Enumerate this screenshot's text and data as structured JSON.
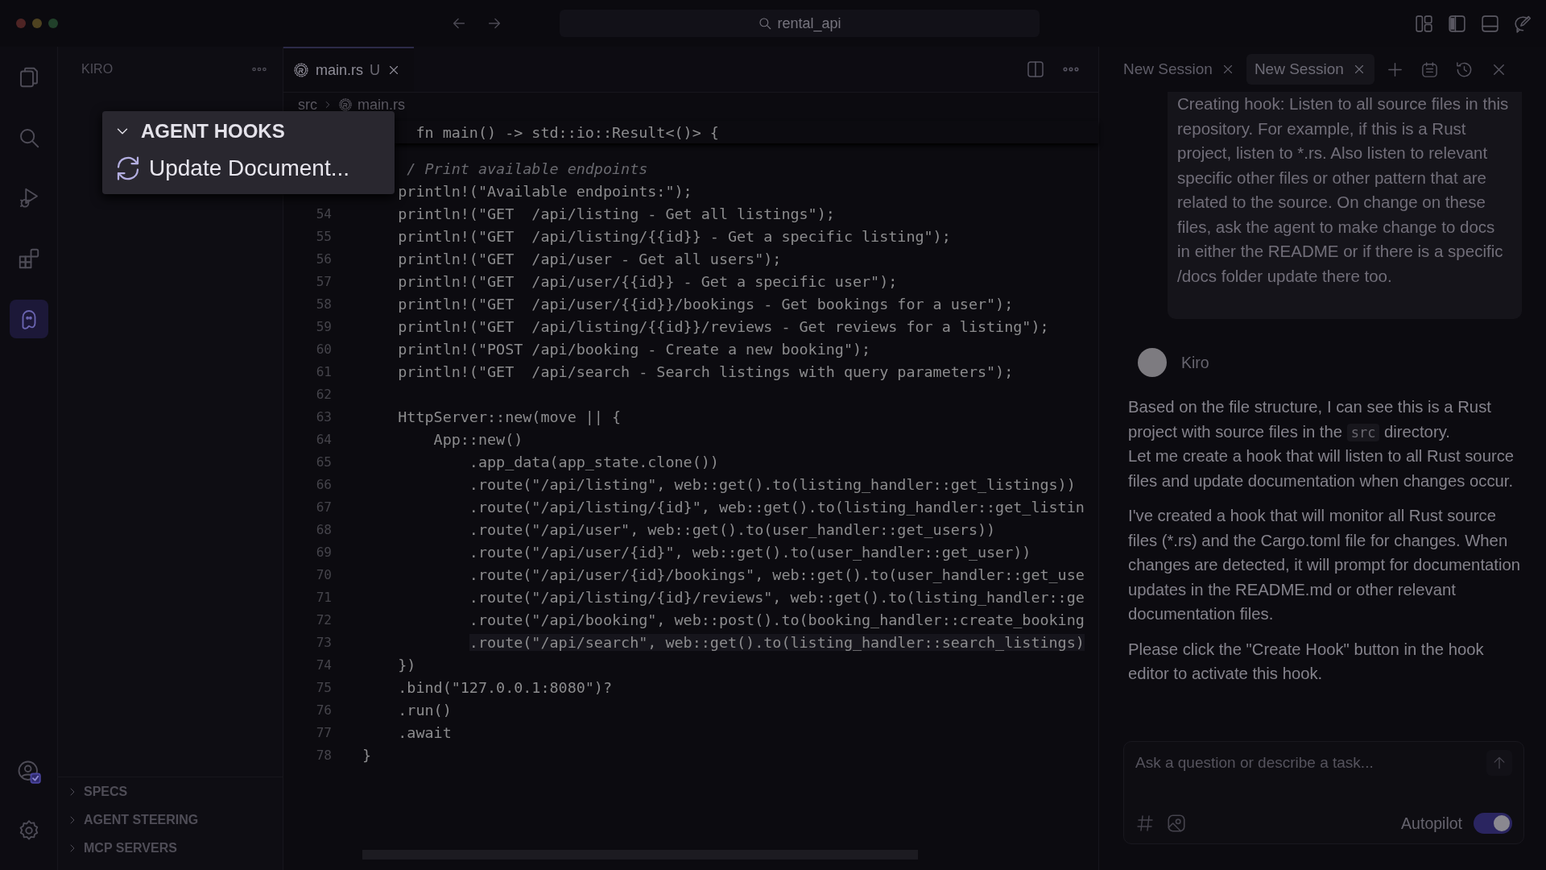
{
  "title_bar": {
    "search": "rental_api"
  },
  "activity_bar": {
    "top": [
      {
        "kind": "explorer",
        "selected": false
      },
      {
        "kind": "search",
        "selected": false
      },
      {
        "kind": "run",
        "selected": false
      },
      {
        "kind": "extensions",
        "selected": false
      },
      {
        "kind": "kiro",
        "selected": true
      }
    ],
    "bottom": [
      {
        "kind": "account",
        "selected": false
      },
      {
        "kind": "settings",
        "selected": false
      }
    ]
  },
  "sidebar": {
    "title": "KIRO",
    "sections": [
      {
        "label": "SPECS",
        "expanded": false
      },
      {
        "label": "AGENT STEERING",
        "expanded": false
      },
      {
        "label": "MCP SERVERS",
        "expanded": false
      }
    ]
  },
  "hooks_popup": {
    "title": "AGENT HOOKS",
    "expanded": true,
    "items": [
      {
        "label": "Update Document..."
      }
    ]
  },
  "editor": {
    "tabs": [
      {
        "label": "main.rs",
        "status": "U",
        "selected": true
      }
    ],
    "breadcrumb": [
      "src",
      "main.rs"
    ],
    "sticky_line": "      fn main() -> std::io::Result<()> {",
    "lines": [
      {
        "text": "     / Print available endpoints",
        "kind": "comment",
        "current": false
      },
      {
        "text": "    println!(\"Available endpoints:\");",
        "kind": "code",
        "current": false
      },
      {
        "number": "54",
        "text": "    println!(\"GET  /api/listing - Get all listings\");",
        "kind": "code",
        "current": false
      },
      {
        "number": "55",
        "text": "    println!(\"GET  /api/listing/{{id}} - Get a specific listing\");",
        "kind": "code",
        "current": false
      },
      {
        "number": "56",
        "text": "    println!(\"GET  /api/user - Get all users\");",
        "kind": "code",
        "current": false
      },
      {
        "number": "57",
        "text": "    println!(\"GET  /api/user/{{id}} - Get a specific user\");",
        "kind": "code",
        "current": false
      },
      {
        "number": "58",
        "text": "    println!(\"GET  /api/user/{{id}}/bookings - Get bookings for a user\");",
        "kind": "code",
        "current": false
      },
      {
        "number": "59",
        "text": "    println!(\"GET  /api/listing/{{id}}/reviews - Get reviews for a listing\");",
        "kind": "code",
        "current": false
      },
      {
        "number": "60",
        "text": "    println!(\"POST /api/booking - Create a new booking\");",
        "kind": "code",
        "current": false
      },
      {
        "number": "61",
        "text": "    println!(\"GET  /api/search - Search listings with query parameters\");",
        "kind": "code",
        "current": false
      },
      {
        "number": "62",
        "kind": "code",
        "current": false
      },
      {
        "number": "63",
        "text": "    HttpServer::new(move || {",
        "kind": "code",
        "current": false
      },
      {
        "number": "64",
        "text": "        App::new()",
        "kind": "code",
        "current": false
      },
      {
        "number": "65",
        "text": "            .app_data(app_state.clone())",
        "kind": "code",
        "current": false
      },
      {
        "number": "66",
        "text": "            .route(\"/api/listing\", web::get().to(listing_handler::get_listings))",
        "kind": "code",
        "current": false
      },
      {
        "number": "67",
        "text": "            .route(\"/api/listing/{id}\", web::get().to(listing_handler::get_listin",
        "kind": "code",
        "current": false
      },
      {
        "number": "68",
        "text": "            .route(\"/api/user\", web::get().to(user_handler::get_users))",
        "kind": "code",
        "current": false
      },
      {
        "number": "69",
        "text": "            .route(\"/api/user/{id}\", web::get().to(user_handler::get_user))",
        "kind": "code",
        "current": false
      },
      {
        "number": "70",
        "text": "            .route(\"/api/user/{id}/bookings\", web::get().to(user_handler::get_use",
        "kind": "code",
        "current": false
      },
      {
        "number": "71",
        "text": "            .route(\"/api/listing/{id}/reviews\", web::get().to(listing_handler::ge",
        "kind": "code",
        "current": false
      },
      {
        "number": "72",
        "text": "            .route(\"/api/booking\", web::post().to(booking_handler::create_booking",
        "kind": "code",
        "current": false
      },
      {
        "number": "73",
        "text": "            .route(\"/api/search\", web::get().to(listing_handler::search_listings)",
        "kind": "code",
        "current": true
      },
      {
        "number": "74",
        "text": "    })",
        "kind": "code",
        "current": false
      },
      {
        "number": "75",
        "text": "    .bind(\"127.0.0.1:8080\")?",
        "kind": "code",
        "current": false
      },
      {
        "number": "76",
        "text": "    .run()",
        "kind": "code",
        "current": false
      },
      {
        "number": "77",
        "text": "    .await",
        "kind": "code",
        "current": false
      },
      {
        "number": "78",
        "text": "}",
        "kind": "code",
        "current": false
      }
    ]
  },
  "chat": {
    "tabs": [
      {
        "label": "New Session",
        "selected": false
      },
      {
        "label": "New Session",
        "selected": true
      }
    ],
    "user_message": "Creating hook: Listen to all source files in this repository. For example, if this is a Rust project, listen to *.rs. Also listen to relevant specific other files or other pattern that are related to the source. On change on these files, ask the agent to make change to docs in either the README or if there is a specific /docs folder update there too.",
    "assistant": {
      "name": "Kiro",
      "paragraphs": [
        {
          "text": "Based on the file structure, I can see this is a Rust project with source files in the ",
          "code": "src",
          "after": " directory.\nLet me create a hook that will listen to all Rust source files and update documentation when changes occur."
        },
        {
          "text": "I've created a hook that will monitor all Rust source files (*.rs) and the Cargo.toml file for changes. When changes are detected, it will prompt for documentation updates in the README.md or other relevant documentation files."
        },
        {
          "text": "Please click the \"Create Hook\" button in the hook editor to activate this hook."
        }
      ]
    },
    "input": {
      "placeholder": "Ask a question or describe a task..."
    },
    "autopilot": {
      "label": "Autopilot",
      "on": true
    }
  }
}
